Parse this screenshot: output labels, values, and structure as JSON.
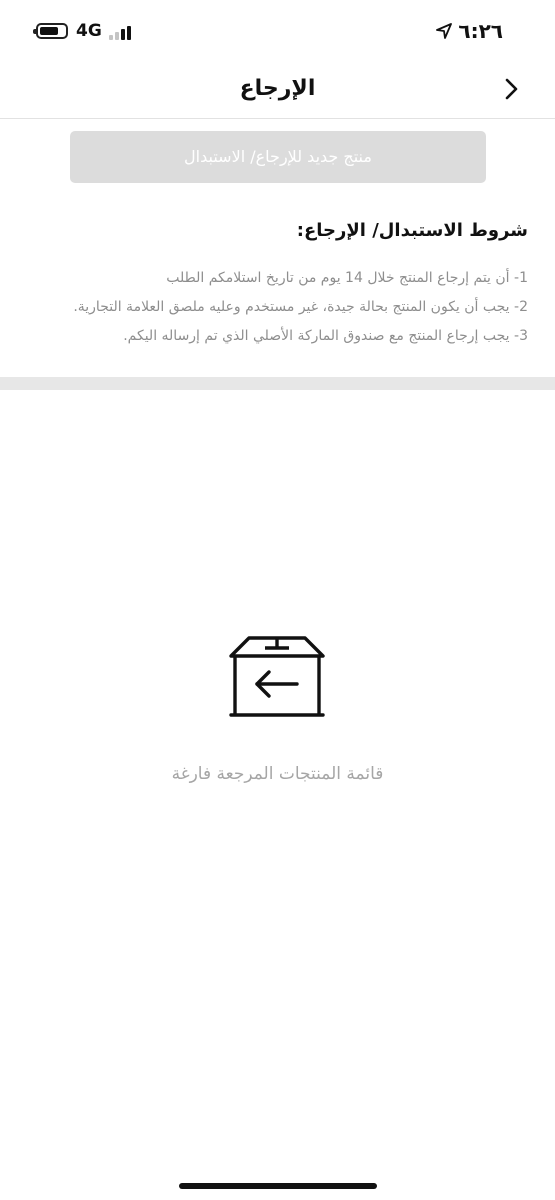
{
  "status_bar": {
    "time": "٦:٢٦",
    "network": "4G",
    "battery_level": 0.75,
    "signal_bars_active": 2,
    "signal_bars_total": 4,
    "icons": [
      "battery-icon",
      "signal-icon",
      "location-arrow-icon"
    ]
  },
  "header": {
    "title": "الإرجاع",
    "back_icon": "chevron-right-icon"
  },
  "new_request_button": {
    "label": "منتج جديد للإرجاع/ الاستبدال",
    "disabled": true
  },
  "conditions": {
    "title": "شروط الاستبدال/ الإرجاع:",
    "items": [
      "1- أن يتم إرجاع المنتج خلال 14 يوم من تاريخ استلامكم الطلب",
      "2- يجب أن يكون المنتج بحالة جيدة، غير مستخدم وعليه ملصق العلامة التجارية.",
      "3- يجب إرجاع المنتج مع صندوق الماركة الأصلي الذي تم إرساله اليكم."
    ]
  },
  "empty_state": {
    "icon": "return-box-icon",
    "message": "قائمة المنتجات المرجعة فارغة"
  },
  "colors": {
    "button_disabled_bg": "#dcdcdc",
    "text_primary": "#111111",
    "text_secondary": "#8e8e8e",
    "divider": "#e7e7e7"
  }
}
